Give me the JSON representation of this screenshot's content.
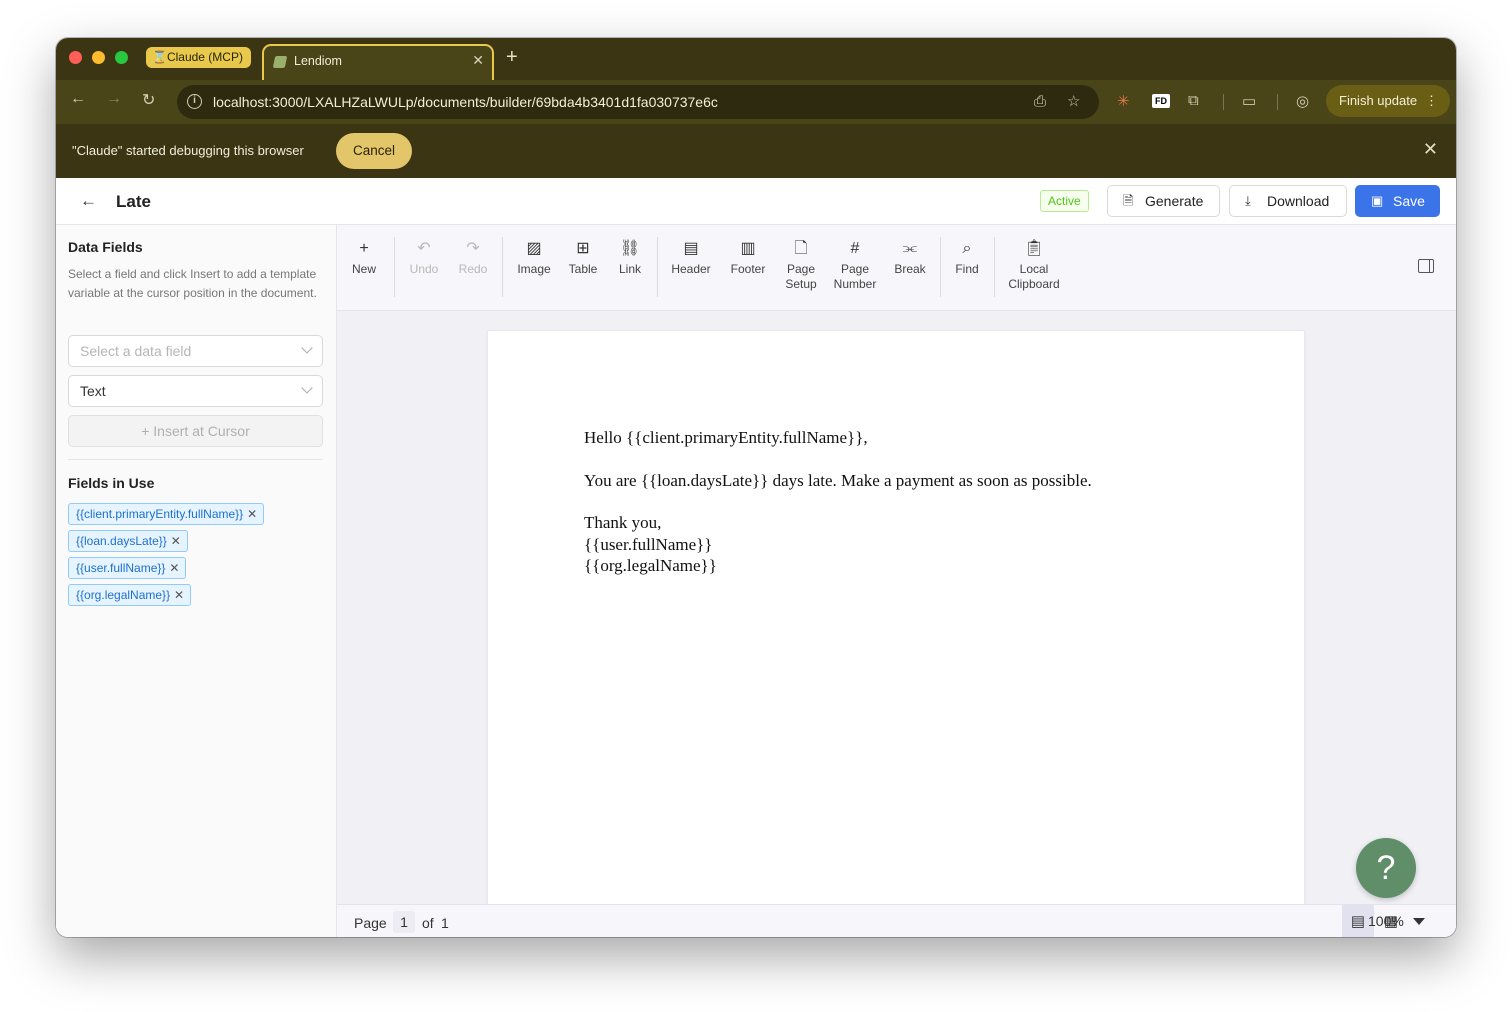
{
  "browser": {
    "tab_group_label": "⌛Claude (MCP)",
    "active_tab_title": "Lendiom",
    "url": "localhost:3000/LXALHZaLWULp/documents/builder/69bda4b3401d1fa030737e6c",
    "finish_update_label": "Finish update",
    "debug_message": "\"Claude\" started debugging this browser",
    "debug_cancel_label": "Cancel"
  },
  "header": {
    "document_title": "Late",
    "status": "Active",
    "generate_label": "Generate",
    "download_label": "Download",
    "save_label": "Save"
  },
  "sidebar": {
    "title": "Data Fields",
    "description": "Select a field and click Insert to add a template variable at the cursor position in the document.",
    "field_select_placeholder": "Select a data field",
    "type_select_value": "Text",
    "insert_label": "+ Insert at Cursor",
    "fields_in_use_title": "Fields in Use",
    "fields_in_use": [
      "{{client.primaryEntity.fullName}}",
      "{{loan.daysLate}}",
      "{{user.fullName}}",
      "{{org.legalName}}"
    ]
  },
  "toolbar": {
    "new": "New",
    "undo": "Undo",
    "redo": "Redo",
    "image": "Image",
    "table": "Table",
    "link": "Link",
    "header": "Header",
    "footer": "Footer",
    "page_setup_1": "Page",
    "page_setup_2": "Setup",
    "page_number_1": "Page",
    "page_number_2": "Number",
    "break": "Break",
    "find": "Find",
    "clipboard_1": "Local",
    "clipboard_2": "Clipboard"
  },
  "document": {
    "line1": "Hello {{client.primaryEntity.fullName}},",
    "line2": "You are {{loan.daysLate}} days late. Make a payment as soon as possible.",
    "line3": "Thank you,",
    "line4": "{{user.fullName}}",
    "line5": "{{org.legalName}}"
  },
  "statusbar": {
    "page_label": "Page",
    "current_page": "1",
    "of_label": "of",
    "total_pages": "1",
    "zoom": "100%"
  },
  "help_label": "?"
}
